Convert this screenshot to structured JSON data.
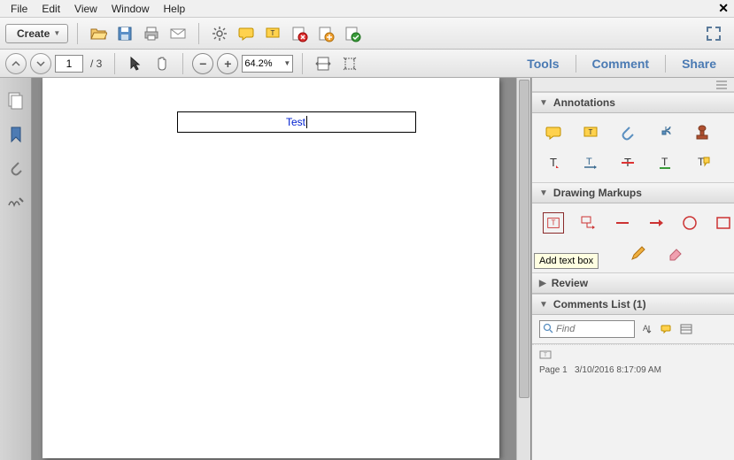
{
  "menubar": {
    "items": [
      "File",
      "Edit",
      "View",
      "Window",
      "Help"
    ]
  },
  "toolbar1": {
    "create_label": "Create"
  },
  "toolbar2": {
    "page_current": "1",
    "page_total": "/ 3",
    "zoom_value": "64.2%"
  },
  "tabs": {
    "tools": "Tools",
    "comment": "Comment",
    "share": "Share"
  },
  "document": {
    "annotation_text": "Test"
  },
  "right_panel": {
    "annotations_label": "Annotations",
    "drawing_label": "Drawing Markups",
    "review_label": "Review",
    "comments_list_label": "Comments List (1)",
    "find_placeholder": "Find",
    "tooltip_add_text_box": "Add text box",
    "comment_entry": {
      "page_line": "Page 1",
      "timestamp": "3/10/2016 8:17:09 AM"
    }
  }
}
